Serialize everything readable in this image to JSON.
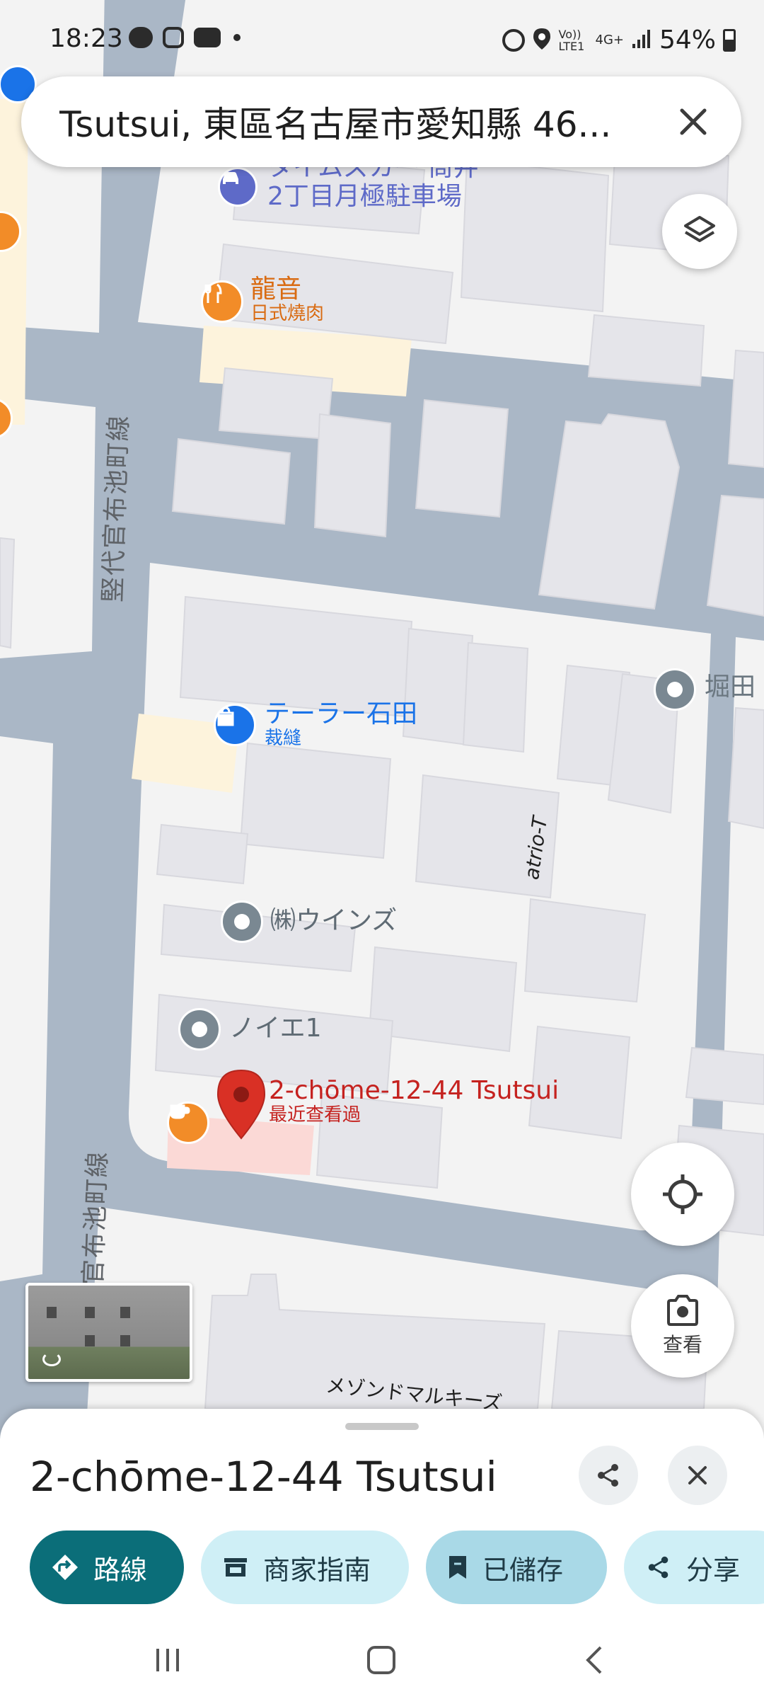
{
  "status_bar": {
    "time": "18:23",
    "battery": "54%",
    "icons_left": [
      "line-icon",
      "instagram-icon",
      "youtube-icon",
      "dot-icon"
    ],
    "icons_right": [
      "alarm-icon",
      "location-icon",
      "volte-icon",
      "4g-icon",
      "signal-icon",
      "battery-icon"
    ],
    "volte_text": "Vo)) LTE1",
    "net_text": "4G+"
  },
  "search": {
    "query": "Tsutsui, 東區名古屋市愛知縣 46..."
  },
  "map": {
    "road_label_1": "竪代官布池町線",
    "road_label_2": "竪代官布池町線",
    "building_label_1": "atrio-T",
    "building_label_2": "メゾンドマルキーズ",
    "pois": {
      "parking": {
        "name_line1": "タイムズカー 筒井",
        "name_line2": "2丁目月極駐車場",
        "icon": "parking-car-icon"
      },
      "ryuon": {
        "name": "龍音",
        "category": "日式燒肉",
        "icon": "restaurant-icon"
      },
      "tailor": {
        "name": "テーラー石田",
        "category": "裁縫",
        "icon": "shopping-bag-icon"
      },
      "horita": {
        "name": "堀田",
        "icon": "pin-icon"
      },
      "wins": {
        "name": "㈱ウインズ",
        "icon": "pin-icon"
      },
      "noie": {
        "name": "ノイエ1",
        "icon": "pin-icon"
      },
      "selected": {
        "name": "2-chōme-12-44 Tsutsui",
        "subtitle": "最近查看過",
        "icon": "red-marker-icon"
      }
    }
  },
  "controls": {
    "lens_label": "查看"
  },
  "sheet": {
    "title": "2-chōme-12-44 Tsutsui",
    "actions": {
      "directions": "路線",
      "merchant": "商家指南",
      "saved": "已儲存",
      "share": "分享"
    }
  },
  "colors": {
    "road": "#aab7c6",
    "block": "#f2f2f2",
    "building": "#e5e5ea",
    "accent": "#0b6e79",
    "marker": "#d93025",
    "poi_orange": "#f28c28",
    "poi_blue": "#1a73e8"
  }
}
